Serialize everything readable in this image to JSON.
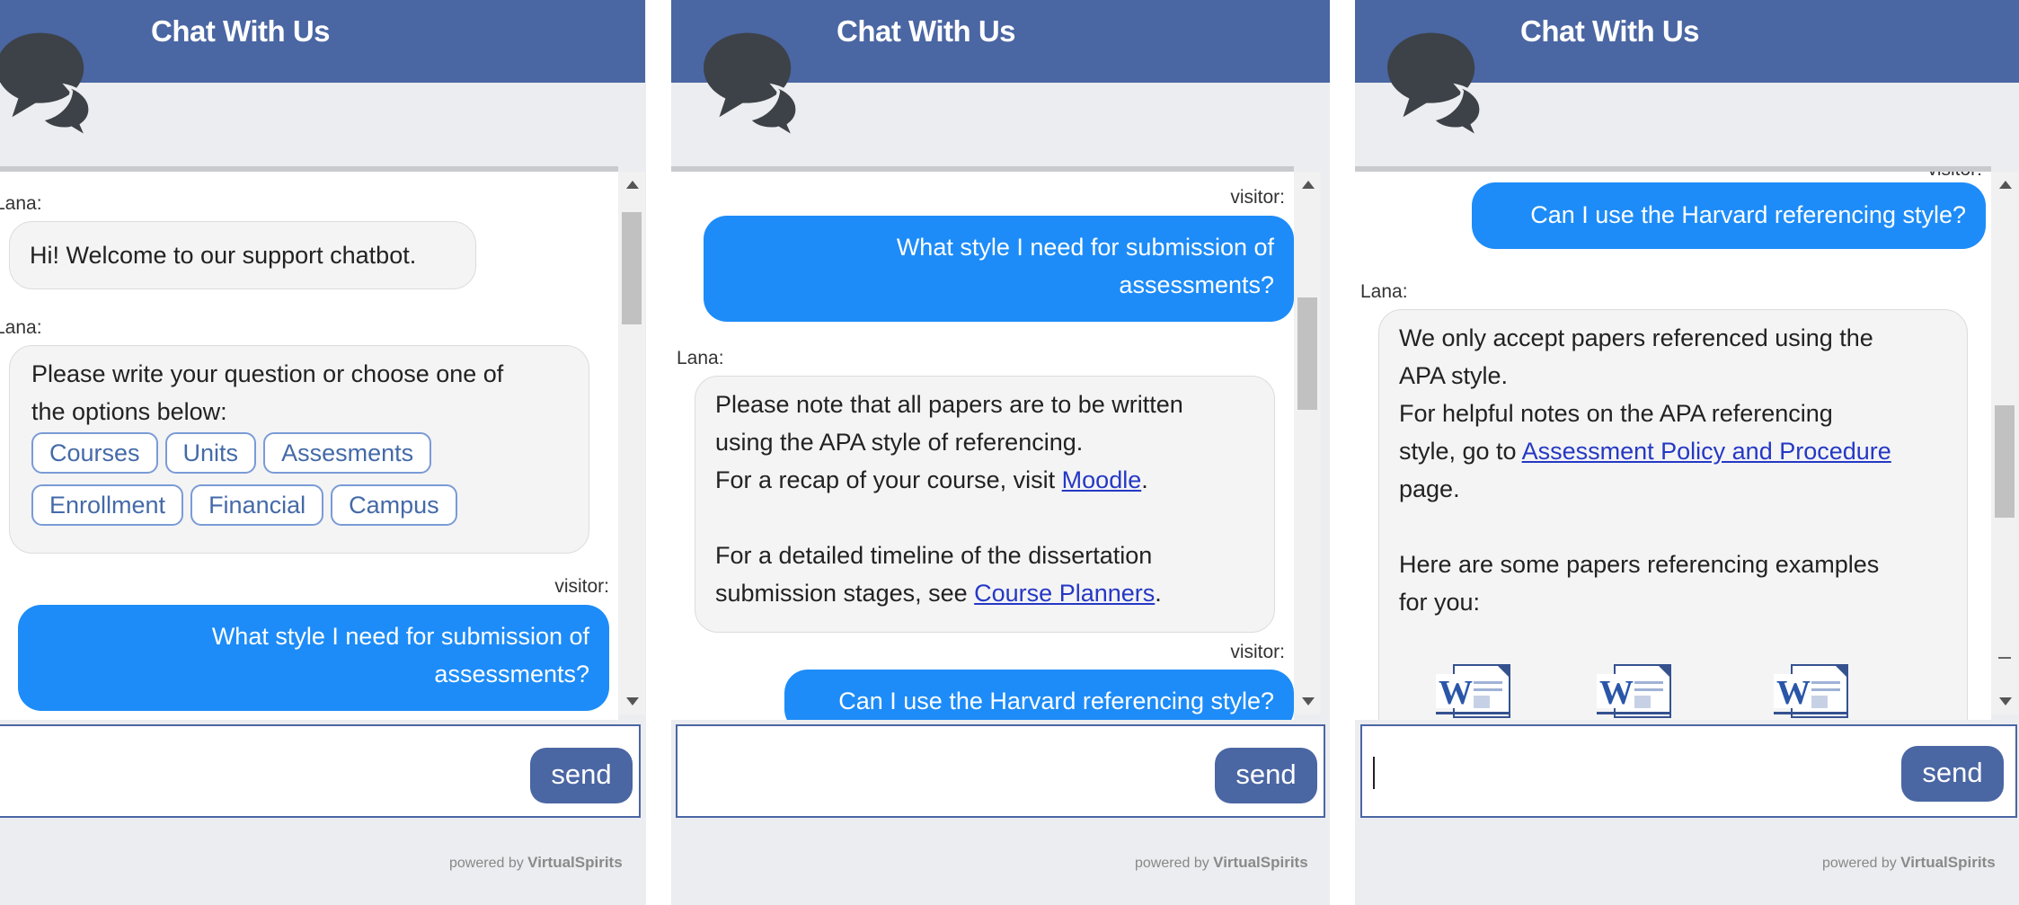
{
  "panels": [
    {
      "header": {
        "title": "Chat With Us"
      },
      "messages": [
        {
          "sender": "Lana:",
          "text": "Hi! Welcome to our support chatbot."
        },
        {
          "sender": "Lana:",
          "text_lines": [
            "Please write your question or choose one of",
            "the options below:"
          ],
          "chips": [
            "Courses",
            "Units",
            "Assesments",
            "Enrollment",
            "Financial",
            "Campus"
          ]
        },
        {
          "sender": "visitor:",
          "text_lines": [
            "What style I need for submission of",
            "assessments?"
          ]
        }
      ],
      "input": {
        "value": "",
        "send_label": "send"
      },
      "powered": {
        "prefix": "powered by",
        "brand": "VirtualSpirits"
      }
    },
    {
      "header": {
        "title": "Chat With Us"
      },
      "messages": [
        {
          "sender": "visitor:",
          "text_lines": [
            "What style I need for submission of",
            "assessments?"
          ]
        },
        {
          "sender": "Lana:",
          "lines": [
            "Please note that all papers are to be written",
            "using the APA style of referencing.",
            "For a recap of your course, visit",
            "Moodle",
            "For a detailed timeline of the dissertation",
            "submission stages, see",
            "Course Planners"
          ]
        },
        {
          "sender": "visitor:",
          "text": "Can I use the Harvard referencing style?"
        }
      ],
      "input": {
        "value": "",
        "send_label": "send"
      },
      "powered": {
        "prefix": "powered by",
        "brand": "VirtualSpirits"
      }
    },
    {
      "header": {
        "title": "Chat With Us"
      },
      "messages": [
        {
          "sender": "visitor:",
          "text": "Can I use the Harvard referencing style?"
        },
        {
          "sender": "Lana:",
          "lines": [
            "We only accept papers referenced using the",
            "APA style.",
            "For helpful notes on the APA referencing",
            "style, go to",
            "Assessment Policy and Procedure",
            "page.",
            "Here are some papers referencing examples",
            "for you:"
          ]
        }
      ],
      "doc_icons": [
        "word-doc-icon",
        "word-doc-icon",
        "word-doc-icon"
      ],
      "input": {
        "value": "",
        "send_label": "send"
      },
      "powered": {
        "prefix": "powered by",
        "brand": "VirtualSpirits"
      }
    }
  ],
  "colors": {
    "header": "#4a66a3",
    "visitor_bubble": "#1d8cf8",
    "link": "#2538c4"
  }
}
